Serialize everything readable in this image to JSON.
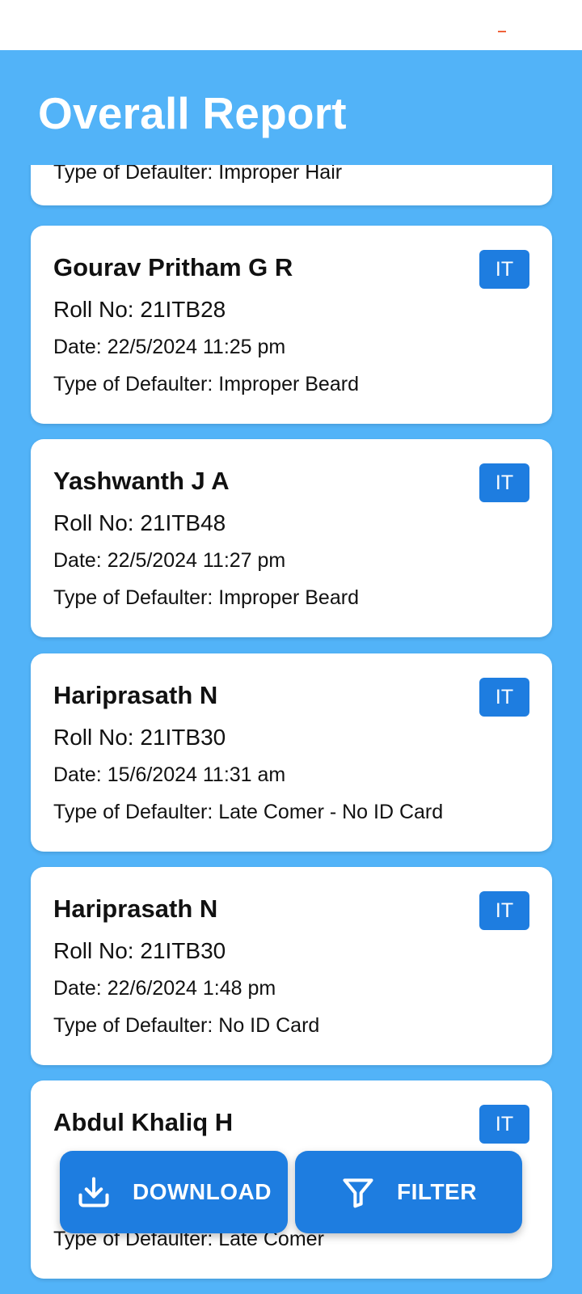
{
  "header": {
    "title": "Overall Report"
  },
  "records": [
    {
      "name": "",
      "roll": "",
      "date": "",
      "type": "Type of Defaulter: Improper Hair",
      "dept": ""
    },
    {
      "name": "Gourav Pritham G R",
      "roll": "Roll No: 21ITB28",
      "date": "Date: 22/5/2024 11:25 pm",
      "type": "Type of Defaulter: Improper Beard",
      "dept": "IT"
    },
    {
      "name": "Yashwanth J A",
      "roll": "Roll No: 21ITB48",
      "date": "Date: 22/5/2024 11:27 pm",
      "type": "Type of Defaulter: Improper Beard",
      "dept": "IT"
    },
    {
      "name": "Hariprasath N",
      "roll": "Roll No: 21ITB30",
      "date": "Date: 15/6/2024 11:31 am",
      "type": "Type of Defaulter: Late Comer - No ID Card",
      "dept": "IT"
    },
    {
      "name": "Hariprasath N",
      "roll": "Roll No: 21ITB30",
      "date": "Date: 22/6/2024 1:48 pm",
      "type": "Type of Defaulter: No ID Card",
      "dept": "IT"
    },
    {
      "name": "Abdul Khaliq H",
      "roll": "",
      "date": "",
      "type": "Type of Defaulter: Late Comer",
      "dept": "IT"
    }
  ],
  "actions": {
    "download_label": "DOWNLOAD",
    "filter_label": "FILTER",
    "download_icon": "download-icon",
    "filter_icon": "filter-funnel-icon"
  },
  "colors": {
    "background": "#52b3f8",
    "accent": "#1e7de0",
    "card": "#ffffff",
    "status_indicator": "#f0623a"
  }
}
